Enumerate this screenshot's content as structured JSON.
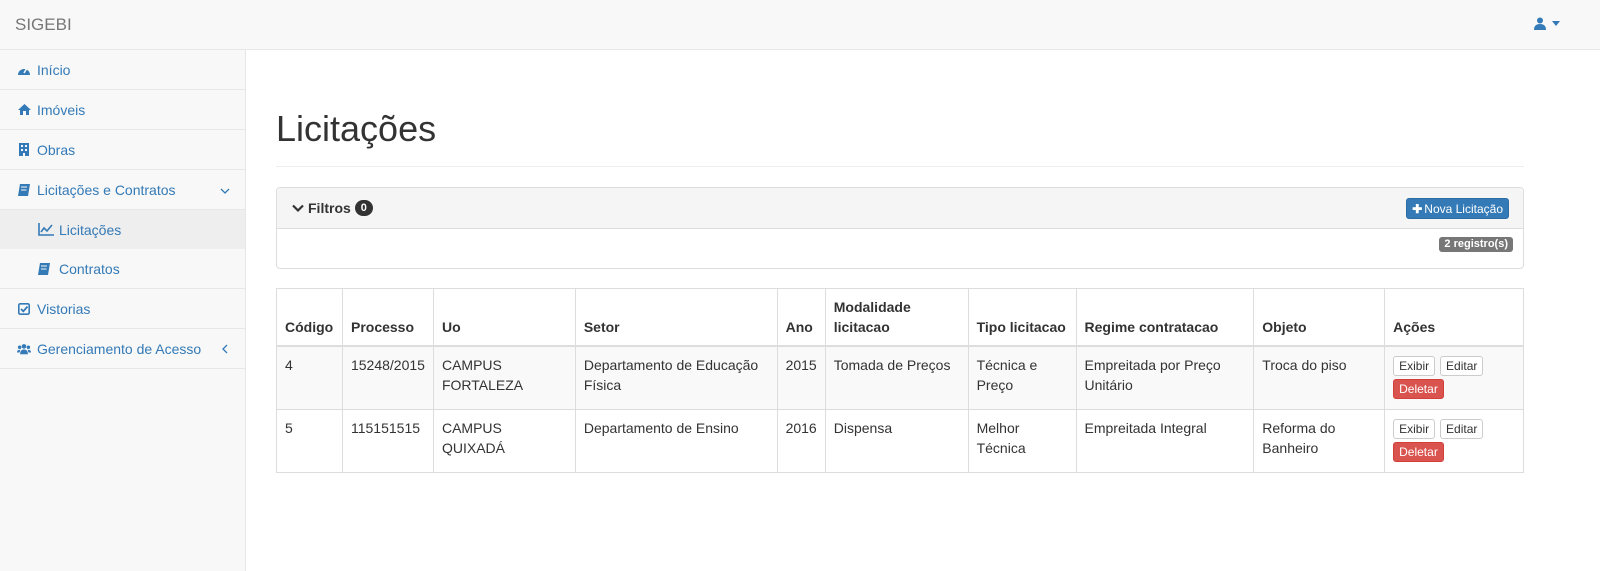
{
  "navbar": {
    "brand": "SIGEBI"
  },
  "sidebar": {
    "items": [
      {
        "label": "Início"
      },
      {
        "label": "Imóveis"
      },
      {
        "label": "Obras"
      },
      {
        "label": "Licitações e Contratos"
      },
      {
        "label": "Vistorias"
      },
      {
        "label": "Gerenciamento de Acesso"
      }
    ],
    "subitems": [
      {
        "label": "Licitações"
      },
      {
        "label": "Contratos"
      }
    ]
  },
  "page": {
    "title": "Licitações"
  },
  "filters": {
    "label": "Filtros",
    "count": "0",
    "new_button": "Nova Licitação",
    "records": "2 registro(s)"
  },
  "table": {
    "headers": [
      "Código",
      "Processo",
      "Uo",
      "Setor",
      "Ano",
      "Modalidade licitacao",
      "Tipo licitacao",
      "Regime contratacao",
      "Objeto",
      "Ações"
    ],
    "rows": [
      [
        "4",
        "15248/2015",
        "CAMPUS FORTALEZA",
        "Departamento de Educação Física",
        "2015",
        "Tomada de Preços",
        "Técnica e Preço",
        "Empreitada por Preço Unitário",
        "Troca do piso"
      ],
      [
        "5",
        "115151515",
        "CAMPUS QUIXADÁ",
        "Departamento de Ensino",
        "2016",
        "Dispensa",
        "Melhor Técnica",
        "Empreitada Integral",
        "Reforma do Banheiro"
      ]
    ],
    "actions": {
      "show": "Exibir",
      "edit": "Editar",
      "delete": "Deletar"
    }
  },
  "colors": {
    "link": "#337ab7",
    "danger": "#d9534f",
    "primary": "#337ab7"
  }
}
